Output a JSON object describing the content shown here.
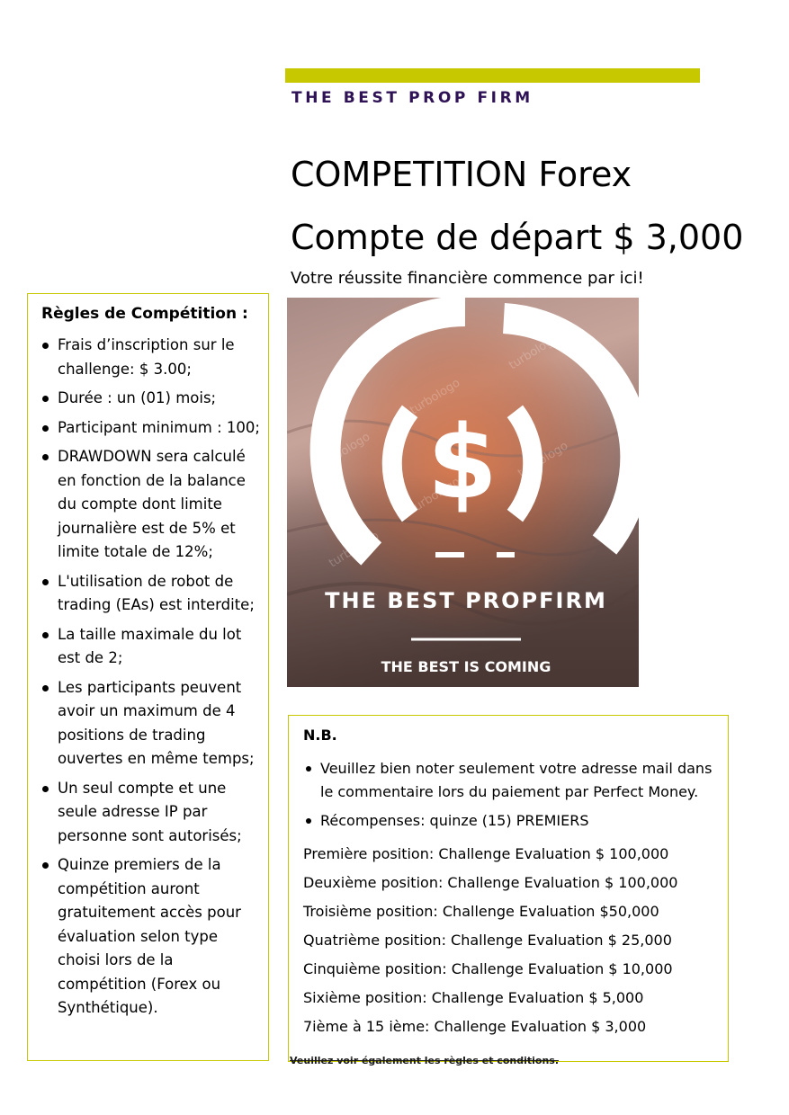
{
  "header": {
    "brand": "THE BEST PROP FIRM",
    "title_line1": "COMPETITION Forex",
    "title_line2": "Compte de départ $ 3,000",
    "tagline": "Votre réussite financière commence par ici!"
  },
  "rules": {
    "heading": "Règles de Compétition :",
    "items": [
      "Frais d’inscription sur le challenge: $ 3.00;",
      "Durée : un (01) mois;",
      "Participant minimum : 100;",
      "DRAWDOWN sera calculé en fonction de la balance du compte dont limite  journalière est de 5% et limite totale de 12%;",
      "L'utilisation de robot de trading (EAs) est interdite;",
      "La taille maximale du lot est de 2;",
      "Les participants peuvent avoir un maximum de 4 positions de trading ouvertes en même temps;",
      "Un seul compte et une seule adresse IP par personne sont autorisés;",
      "Quinze premiers de la compétition auront gratuitement accès pour évaluation selon type choisi lors de la compétition (Forex ou Synthétique)."
    ]
  },
  "promo_image": {
    "brand_text": "THE BEST PROPFIRM",
    "slogan": "THE BEST IS COMING",
    "watermark": "turbologo",
    "symbol": "$",
    "colors": {
      "rock_light": "#c9a59a",
      "rock_dark": "#7a5e58",
      "glow": "#d9663a",
      "logo": "#ffffff"
    }
  },
  "nb": {
    "heading": "N.B.",
    "items": [
      "Veuillez bien noter seulement votre adresse mail dans le commentaire lors du paiement par Perfect Money.",
      "Récompenses:  quinze (15) PREMIERS"
    ],
    "prizes": [
      "Première position: Challenge Evaluation $ 100,000",
      "Deuxième position: Challenge Evaluation $ 100,000",
      "Troisième position: Challenge Evaluation $50,000",
      "Quatrième position: Challenge Evaluation $ 25,000",
      "Cinquième position: Challenge Evaluation $ 10,000",
      "Sixième position: Challenge Evaluation $ 5,000",
      "7ième à 15 ième: Challenge Evaluation $ 3,000"
    ]
  },
  "footer": {
    "note": "Veuillez voir également les règles et conditions."
  },
  "colors": {
    "accent": "#c8c800",
    "brand_text": "#2e1255"
  }
}
